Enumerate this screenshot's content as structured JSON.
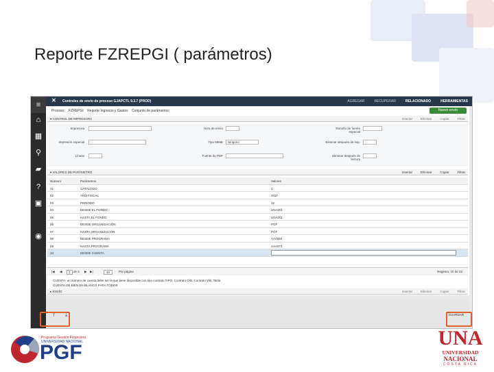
{
  "slide": {
    "title": "Reporte FZREPGI ( parámetros)"
  },
  "app": {
    "window_title": "Controles de envío de proceso GJAPCTL 9.3.7 (PROD)",
    "top_actions": [
      "AGREGAR",
      "RECUPERAR",
      "RELACIONADO",
      "HERRAMIENTAS"
    ],
    "breadcrumb": [
      "Proceso:",
      "FZREPGI",
      "Reporte Ingresos y Gastos",
      "Conjunto de parámetros:"
    ],
    "new_button": "Nuevo envío",
    "sidebar_icons": [
      "menu-icon",
      "home-icon",
      "grid-icon",
      "search-icon",
      "folder-icon",
      "help-icon",
      "lock-icon",
      "user-icon"
    ]
  },
  "printer_section": {
    "header": "CONTROL DE IMPRESORA",
    "tools": [
      "Insertar",
      "Eliminar",
      "Copiar",
      "Filtrar"
    ],
    "fields": {
      "printer_label": "Impresora",
      "time_label": "Hora de envío",
      "font_size_label": "Tamaño de fuente especial",
      "special_print_label": "Impresión especial",
      "mime_label": "Tipo MIME",
      "mime_value": "Ninguno",
      "delete_label": "Eliminar después de imp.",
      "lines_label": "Líneas",
      "pdf_font_label": "Fuente de PDF",
      "delete_after_label": "Eliminar después de lectura"
    }
  },
  "values_section": {
    "header": "VALORES DE PARÁMETRO",
    "tools": [
      "Insertar",
      "Eliminar",
      "Copiar",
      "Filtrar"
    ],
    "columns": [
      "Número",
      "Parámetros",
      "Valores"
    ],
    "rows": [
      [
        "01",
        "CATÁLOGO",
        "C"
      ],
      [
        "02",
        "AÑO FISCAL",
        "2017"
      ],
      [
        "03",
        "PERIODO",
        "12"
      ],
      [
        "04",
        "DESDE EL FONDO",
        "UNA001"
      ],
      [
        "05",
        "HASTA EL FONDO",
        "UNA001"
      ],
      [
        "06",
        "DESDE ORGANIZACIÓN",
        "PGF"
      ],
      [
        "07",
        "HASTA ORGANIZACIÓN",
        "PGF"
      ],
      [
        "08",
        "DESDE PROGRAMA",
        "AAA004"
      ],
      [
        "09",
        "HASTA PROGRAMA",
        "AAA074"
      ],
      [
        "10",
        "DESDE CUENTA",
        ""
      ]
    ],
    "pager": {
      "page": "1",
      "of": "de 2",
      "per_page": "10",
      "per_page_label": "Por página",
      "record": "Registro: 10 de 22"
    },
    "message_line1": "CUENTA: un número de cuenta debe ser la que tiene disponible con tipo contrato TIPO, Contrato O/B, Contrato V/B, Tabla",
    "message_line2": "CUENTA DE BIEN EN BLANCO PARA TODOS"
  },
  "submit_section": {
    "header": "ENVÍO"
  },
  "bottom": {
    "submit_label": "GUARDAR"
  },
  "logos": {
    "pgf_line1": "Programa Gestión Financiera",
    "pgf_line2": "UNIVERSIDAD NACIONAL",
    "pgf_text": "PGF",
    "una_big": "UNA",
    "una_line1": "UNIVERSIDAD",
    "una_line2": "NACIONAL",
    "una_line3": "COSTA RICA"
  },
  "colors": {
    "accent": "#e0622a",
    "header_dark": "#28374a",
    "sidebar": "#2b2b2b",
    "new_btn": "#3b8a3b",
    "una_red": "#c0262d"
  }
}
